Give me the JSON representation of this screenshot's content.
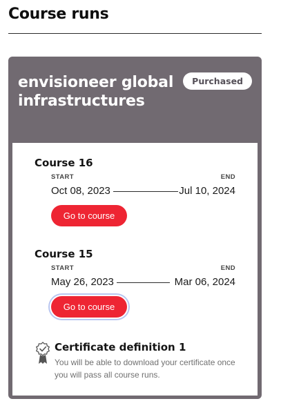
{
  "page": {
    "title": "Course runs"
  },
  "card": {
    "title": "envisioneer global infrastructures",
    "badge": "Purchased",
    "header_color": "#716a71",
    "runs": [
      {
        "name": "Course 16",
        "start_label": "START",
        "end_label": "END",
        "start_date": "Oct 08, 2023",
        "end_date": "Jul 10, 2024",
        "button_label": "Go to course"
      },
      {
        "name": "Course 15",
        "start_label": "START",
        "end_label": "END",
        "start_date": "May 26, 2023",
        "end_date": "Mar 06, 2024",
        "button_label": "Go to course"
      }
    ],
    "certificate": {
      "icon": "certificate-ribbon-icon",
      "title": "Certificate definition 1",
      "description": "You will be able to download your certificate once you will pass all course runs."
    }
  },
  "colors": {
    "accent": "#ee2533",
    "focus_ring": "#b9c6f0"
  }
}
